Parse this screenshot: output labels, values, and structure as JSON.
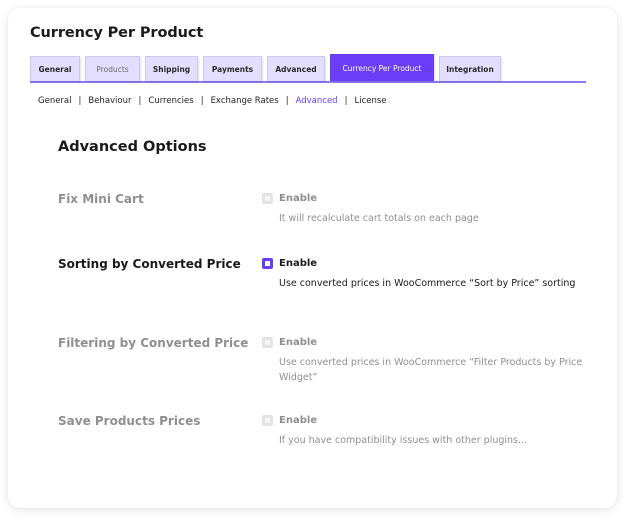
{
  "page": {
    "title": "Currency Per Product"
  },
  "tabs": [
    {
      "label": "General",
      "state": "normal"
    },
    {
      "label": "Products",
      "state": "dim"
    },
    {
      "label": "Shipping",
      "state": "normal"
    },
    {
      "label": "Payments",
      "state": "normal"
    },
    {
      "label": "Advanced",
      "state": "normal"
    },
    {
      "label": "Currency Per Product",
      "state": "active"
    },
    {
      "label": "Integration",
      "state": "normal"
    }
  ],
  "subnav": {
    "items": [
      {
        "label": "General",
        "current": false
      },
      {
        "label": "Behaviour",
        "current": false
      },
      {
        "label": "Currencies",
        "current": false
      },
      {
        "label": "Exchange Rates",
        "current": false
      },
      {
        "label": "Advanced",
        "current": true
      },
      {
        "label": "License",
        "current": false
      }
    ],
    "separator": "|"
  },
  "section": {
    "title": "Advanced Options"
  },
  "options": [
    {
      "label": "Fix Mini Cart",
      "checkbox_label": "Enable",
      "checked": false,
      "description": "It will recalculate cart totals on each page"
    },
    {
      "label": "Sorting by Converted Price",
      "checkbox_label": "Enable",
      "checked": true,
      "description": "Use converted prices in WooCommerce “Sort by Price” sorting"
    },
    {
      "label": "Filtering by Converted Price",
      "checkbox_label": "Enable",
      "checked": false,
      "description": "Use converted prices in WooCommerce “Filter Products by Price Widget”"
    },
    {
      "label": "Save Products Prices",
      "checkbox_label": "Enable",
      "checked": false,
      "description": "If you have compatibility issues with other plugins..."
    }
  ],
  "colors": {
    "accent": "#6a3df6",
    "tab_background": "#e3ddfe",
    "underline": "#8b78f5",
    "muted_text": "#8f8f8f"
  }
}
